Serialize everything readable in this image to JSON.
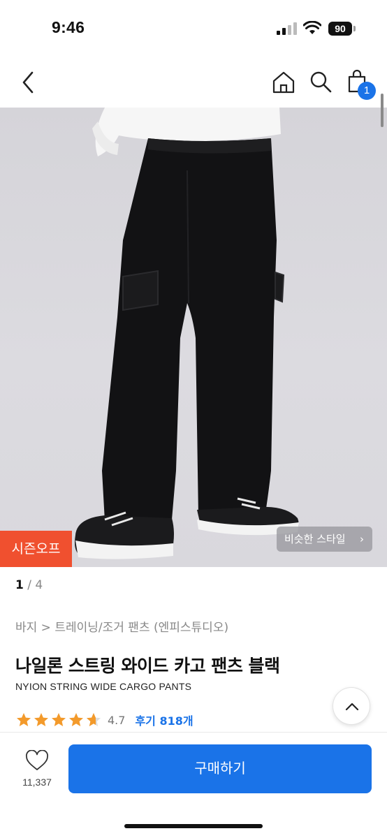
{
  "status": {
    "time": "9:46",
    "battery": "90"
  },
  "nav": {
    "cart_count": "1"
  },
  "image": {
    "season_badge": "시즌오프",
    "similar_style": "비슷한 스타일",
    "pager_current": "1",
    "pager_total": " / 4"
  },
  "product": {
    "breadcrumb": "바지 > 트레이닝/조거 팬츠 (엔피스튜디오)",
    "title_ko": "나일론 스트링 와이드 카고 팬츠 블랙",
    "title_en": "NYION STRING WIDE CARGO PANTS",
    "rating": 4.7,
    "rating_text": "4.7",
    "reviews": "후기 818개"
  },
  "bottom": {
    "like_count": "11,337",
    "buy_label": "구매하기"
  },
  "colors": {
    "accent": "#1a73e8",
    "badge": "#f0502f",
    "star": "#f39a2b"
  },
  "icons": [
    "chevron-left-icon",
    "home-icon",
    "search-icon",
    "shopping-bag-icon",
    "chevron-up-icon",
    "heart-icon",
    "star-icon"
  ]
}
